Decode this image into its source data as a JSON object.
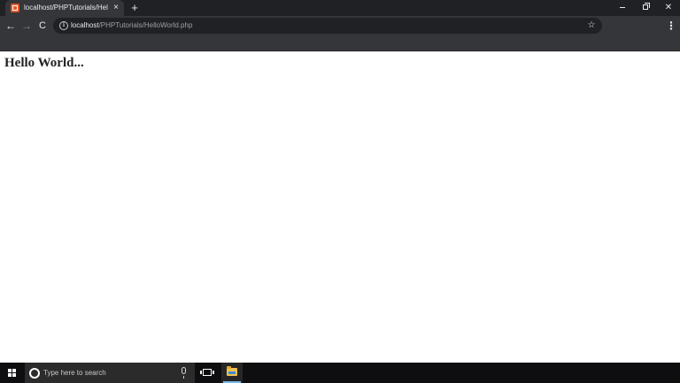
{
  "browser": {
    "tab": {
      "title": "localhost/PHPTutorials/HelloWo",
      "close_glyph": "×"
    },
    "new_tab_glyph": "+",
    "window_controls": {
      "close_glyph": "✕"
    },
    "toolbar": {
      "back_glyph": "←",
      "forward_glyph": "→",
      "reload_glyph": "C",
      "info_glyph": "i",
      "url_host": "localhost",
      "url_path": "/PHPTutorials/HelloWorld.php",
      "star_glyph": "☆",
      "menu_glyph": "⋮"
    },
    "colors": {
      "titlebar": "#202124",
      "toolbar": "#35363a",
      "omnibox": "#202124",
      "favicon": "#e2592a"
    }
  },
  "page": {
    "heading": "Hello World..."
  },
  "taskbar": {
    "search_placeholder": "Type here to search",
    "icons": [
      "windows-start-icon",
      "cortana-icon",
      "microphone-icon",
      "task-view-icon",
      "file-explorer-icon"
    ],
    "colors": {
      "background": "#0e0e10",
      "search_box": "#2b2b2b",
      "active_indicator": "#76b9ed"
    }
  }
}
